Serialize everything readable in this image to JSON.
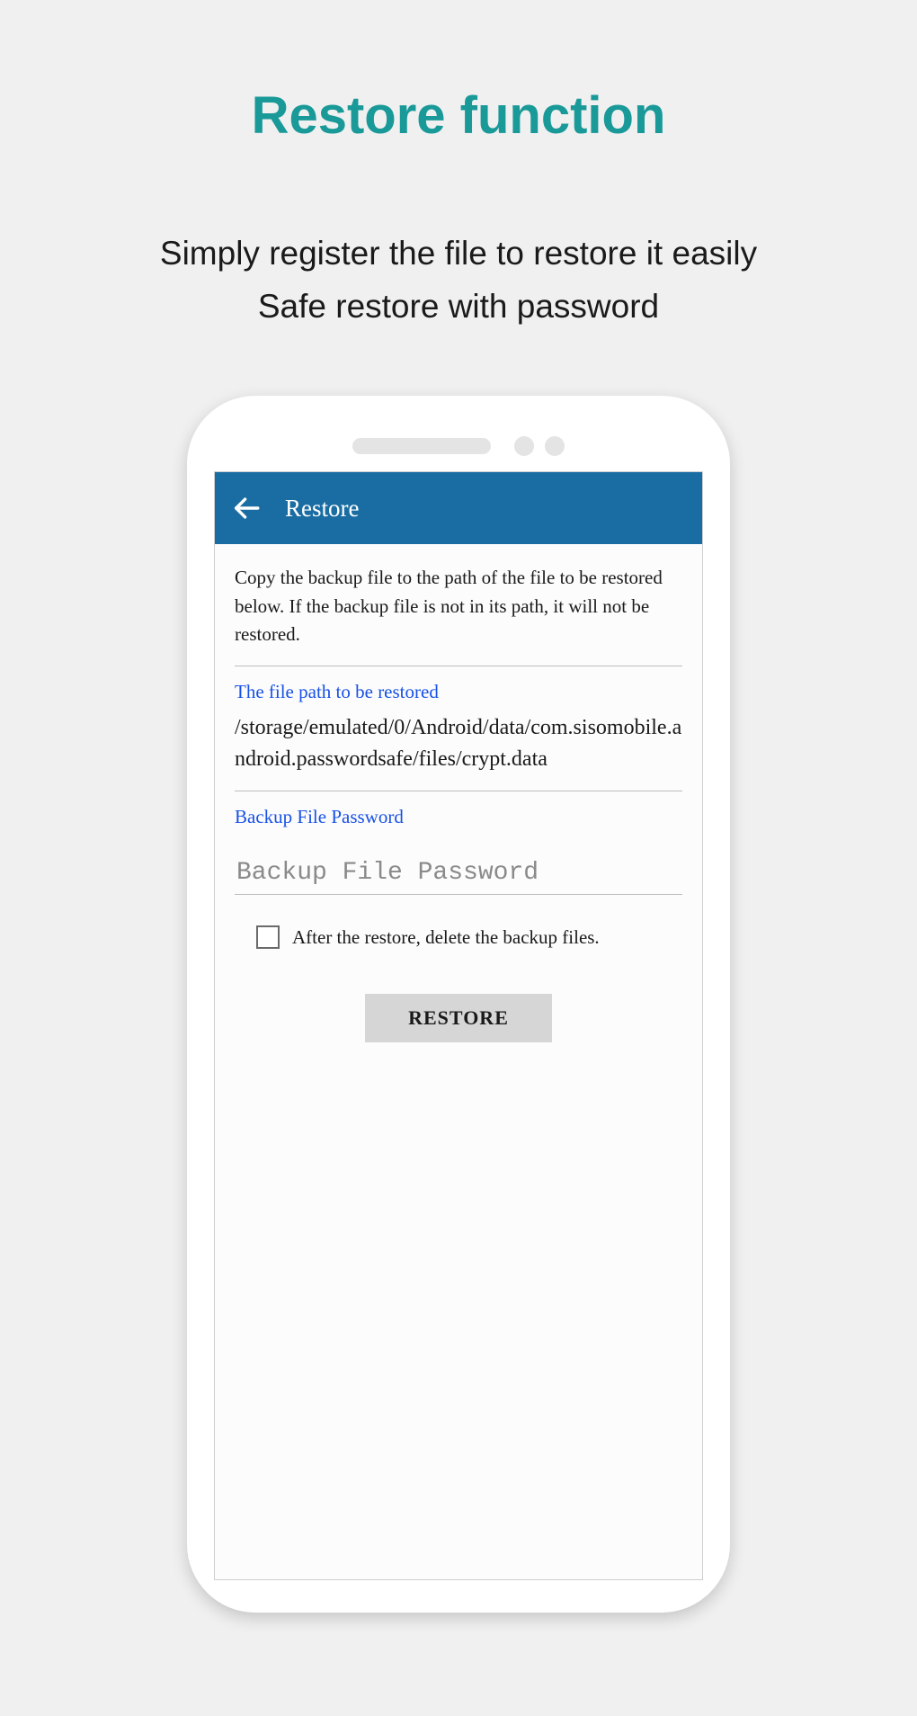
{
  "page": {
    "title": "Restore function",
    "subtitle_line1": "Simply register the file to restore it easily",
    "subtitle_line2": "Safe restore with password"
  },
  "appbar": {
    "title": "Restore"
  },
  "content": {
    "instruction": "Copy the backup file to the path of the file to be restored below. If the backup file is not in its path, it will not be restored.",
    "file_path_label": "The file path to be restored",
    "file_path_value": "/storage/emulated/0/Android/data/com.sisomobile.android.passwordsafe/files/crypt.data",
    "password_label": "Backup File Password",
    "password_placeholder": "Backup File Password",
    "password_value": "",
    "delete_checkbox_label": "After the restore, delete the backup files.",
    "delete_checkbox_checked": false,
    "restore_button_label": "RESTORE"
  },
  "colors": {
    "accent_title": "#1a9999",
    "appbar_bg": "#1a6da3",
    "link_blue": "#1751e6"
  }
}
